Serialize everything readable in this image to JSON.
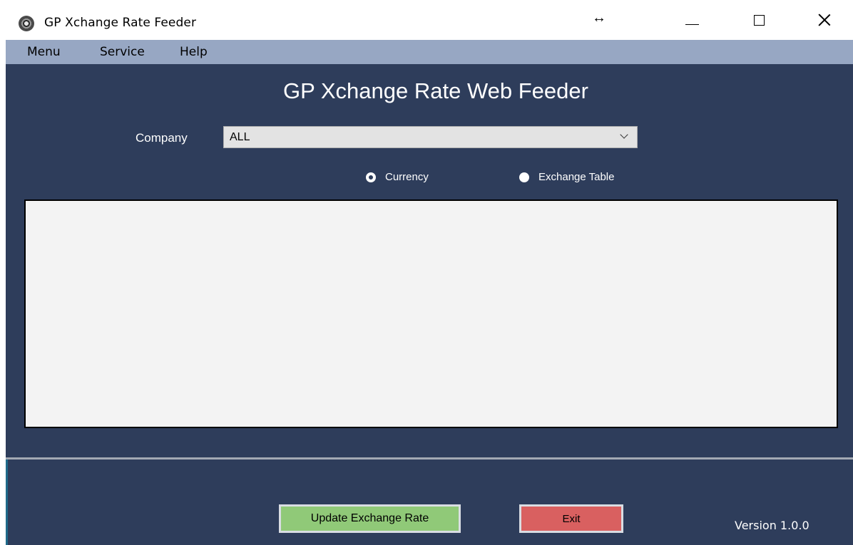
{
  "window": {
    "title": "GP Xchange Rate Feeder",
    "resize_indicator": "↔"
  },
  "menubar": {
    "items": [
      {
        "label": "Menu"
      },
      {
        "label": "Service"
      },
      {
        "label": "Help"
      }
    ]
  },
  "main": {
    "heading": "GP Xchange Rate Web Feeder",
    "company": {
      "label": "Company",
      "selected": "ALL"
    },
    "view_options": [
      {
        "label": "Currency",
        "checked": true
      },
      {
        "label": "Exchange Table",
        "checked": false
      }
    ]
  },
  "footer": {
    "update_button_label": "Update Exchange Rate",
    "exit_button_label": "Exit",
    "version": "Version 1.0.0"
  },
  "colors": {
    "panel_bg": "#2e3d5b",
    "menubar_bg": "#97a7c3",
    "update_button": "#90c978",
    "exit_button": "#d96060"
  },
  "icons": {
    "app": "disc-icon",
    "minimize": "minimize-icon",
    "maximize": "maximize-icon",
    "close": "close-icon",
    "dropdown": "chevron-down-icon"
  }
}
